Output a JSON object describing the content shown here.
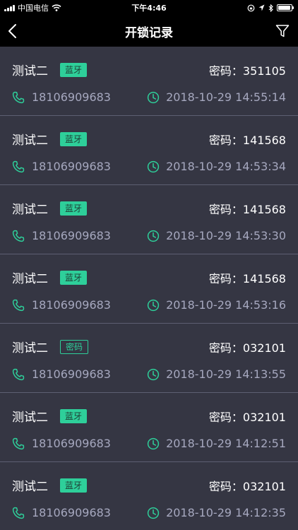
{
  "status_bar": {
    "carrier": "中国电信",
    "time": "下午4:46",
    "battery_level": 0.92
  },
  "nav": {
    "title": "开锁记录"
  },
  "records": [
    {
      "name": "测试二",
      "badge": "蓝牙",
      "badge_style": "solid",
      "password": "密码：351105",
      "phone": "18106909683",
      "time": "2018-10-29 14:55:14"
    },
    {
      "name": "测试二",
      "badge": "蓝牙",
      "badge_style": "solid",
      "password": "密码：141568",
      "phone": "18106909683",
      "time": "2018-10-29 14:53:34"
    },
    {
      "name": "测试二",
      "badge": "蓝牙",
      "badge_style": "solid",
      "password": "密码：141568",
      "phone": "18106909683",
      "time": "2018-10-29 14:53:30"
    },
    {
      "name": "测试二",
      "badge": "蓝牙",
      "badge_style": "solid",
      "password": "密码：141568",
      "phone": "18106909683",
      "time": "2018-10-29 14:53:16"
    },
    {
      "name": "测试二",
      "badge": "密码",
      "badge_style": "outline",
      "password": "密码：032101",
      "phone": "18106909683",
      "time": "2018-10-29 14:13:55"
    },
    {
      "name": "测试二",
      "badge": "蓝牙",
      "badge_style": "solid",
      "password": "密码：032101",
      "phone": "18106909683",
      "time": "2018-10-29 14:12:51"
    },
    {
      "name": "测试二",
      "badge": "蓝牙",
      "badge_style": "solid",
      "password": "密码：032101",
      "phone": "18106909683",
      "time": "2018-10-29 14:12:35"
    }
  ],
  "colors": {
    "accent": "#2ecf9a",
    "card": "#353643",
    "background": "#24252f",
    "secondary_text": "#a6a8bf"
  },
  "icons": {
    "back": "chevron-left-icon",
    "filter": "filter-icon",
    "phone": "phone-icon",
    "clock": "clock-icon"
  }
}
